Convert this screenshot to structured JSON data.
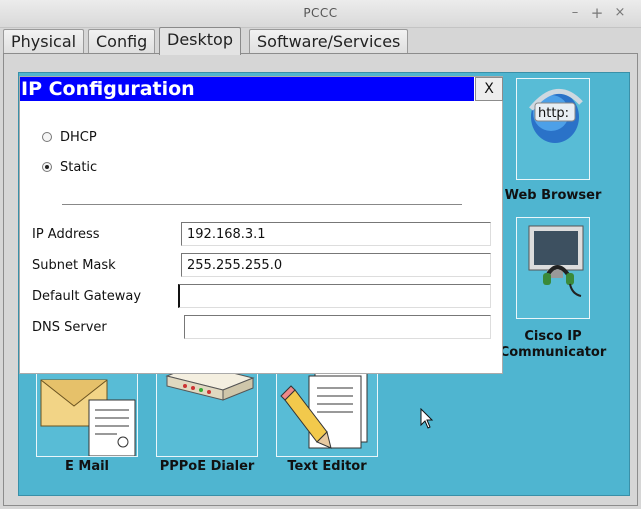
{
  "window": {
    "title": "PCCC",
    "min": "–",
    "max": "+",
    "close": "×"
  },
  "tabs": [
    {
      "label": "Physical"
    },
    {
      "label": "Config"
    },
    {
      "label": "Desktop"
    },
    {
      "label": "Software/Services"
    }
  ],
  "apps": {
    "web_browser": {
      "label": "Web Browser",
      "icon_text": "http:"
    },
    "cisco_ip": {
      "label_line1": "Cisco IP",
      "label_line2": "Communicator"
    },
    "email": {
      "label": "E Mail"
    },
    "pppoe": {
      "label": "PPPoE Dialer"
    },
    "text_editor": {
      "label": "Text Editor"
    }
  },
  "dialog": {
    "title": "IP Configuration",
    "close": "X",
    "dhcp_label": "DHCP",
    "static_label": "Static",
    "mode": "Static",
    "ip_label": "IP Address",
    "ip_value": "192.168.3.1",
    "mask_label": "Subnet Mask",
    "mask_value": "255.255.255.0",
    "gateway_label": "Default Gateway",
    "gateway_value": "",
    "dns_label": "DNS Server",
    "dns_value": ""
  },
  "colors": {
    "desktop_bg": "#4fb5d0",
    "dialog_title_bg": "#0000ff"
  }
}
